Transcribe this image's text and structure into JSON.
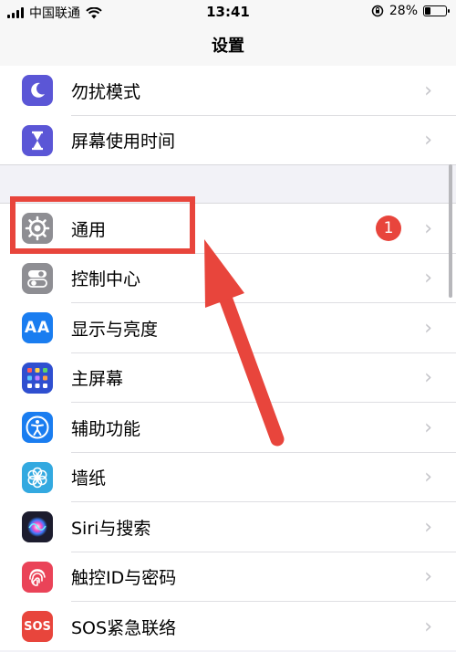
{
  "status_bar": {
    "carrier": "中国联通",
    "time": "13:41",
    "battery_percent": "28%",
    "battery_level": 0.28
  },
  "nav": {
    "title": "设置"
  },
  "groups": [
    [
      {
        "label": "勿扰模式",
        "icon": "moon-icon",
        "color": "#5b56d6"
      },
      {
        "label": "屏幕使用时间",
        "icon": "hourglass-icon",
        "color": "#5b56d6"
      }
    ],
    [
      {
        "label": "通用",
        "icon": "gear-icon",
        "color": "#8e8e93",
        "badge": "1"
      },
      {
        "label": "控制中心",
        "icon": "toggles-icon",
        "color": "#8e8e93"
      },
      {
        "label": "显示与亮度",
        "icon": "text-size-icon",
        "color": "#1a7df0",
        "icon_text": "AA"
      },
      {
        "label": "主屏幕",
        "icon": "home-grid-icon",
        "color": "#2f4fd0"
      },
      {
        "label": "辅助功能",
        "icon": "accessibility-icon",
        "color": "#1a7df0"
      },
      {
        "label": "墙纸",
        "icon": "flower-icon",
        "color": "#33a9e0"
      },
      {
        "label": "Siri与搜索",
        "icon": "siri-icon",
        "color": "#1c1c2e"
      },
      {
        "label": "触控ID与密码",
        "icon": "fingerprint-icon",
        "color": "#ea4358"
      },
      {
        "label": "SOS紧急联络",
        "icon": "sos-icon",
        "color": "#e8453c",
        "icon_text": "SOS"
      }
    ]
  ]
}
